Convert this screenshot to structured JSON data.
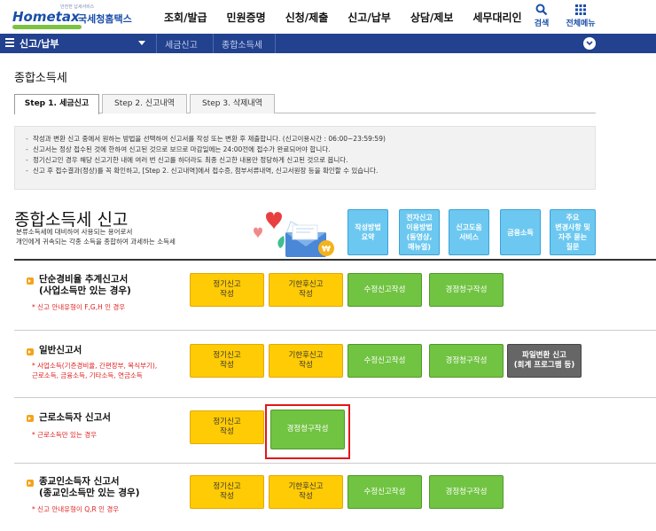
{
  "header": {
    "logo_tiny": "안전한 납세서비스",
    "logo_brand": "Hometax",
    "logo_sub": "국세청홈택스",
    "menu": [
      "조회/발급",
      "민원증명",
      "신청/제출",
      "신고/납부",
      "상담/제보",
      "세무대리인"
    ],
    "search_label": "검색",
    "all_menu_label": "전체메뉴"
  },
  "navbar": {
    "current": "신고/납부",
    "crumbs": [
      "세금신고",
      "종합소득세"
    ]
  },
  "page_title": "종합소득세",
  "tabs": [
    "Step 1. 세금신고",
    "Step 2. 신고내역",
    "Step 3. 삭제내역"
  ],
  "notice": [
    "작성과 변환 신고 중에서 원하는 방법을 선택하여 신고서를 작성 또는 변환 후 제출합니다. (신고이용시간 : 06:00~23:59:59)",
    "신고서는 정상 접수된 것에 한하여 신고된 것으로 보므로 마감일에는 24:00전에 접수가 완료되어야 합니다.",
    "정기신고인 경우 해당 신고기한 내에 여러 번 신고를 하더라도 최종 신고한 내용만 정당하게 신고된 것으로 봅니다.",
    "신고 후 접수결과(정상)를 꼭 확인하고, [Step 2. 신고내역]에서 접수증, 첨부서류내역, 신고서원장 등을 확인할 수 있습니다."
  ],
  "section": {
    "title": "종합소득세 신고",
    "desc1": "분류소득세에 대비하여 사용되는 용어로서",
    "desc2": "개인에게 귀속되는 각종 소득을 종합하여 과세하는 소득세"
  },
  "quick_buttons": [
    "작성방법\n요약",
    "전자신고\n이용방법\n(동영상,\n매뉴얼)",
    "신고도움\n서비스",
    "금융소득",
    "주요\n변경사항 및\n자주 묻는\n질문"
  ],
  "rows": [
    {
      "title": "단순경비율 추계신고서\n(사업소득만 있는 경우)",
      "note": "신고 안내유형이 F,G,H 인 경우",
      "buttons": [
        "정기신고\n작성",
        "기한후신고\n작성",
        "수정신고작성",
        "경정청구작성"
      ]
    },
    {
      "title": "일반신고서",
      "note": "사업소득(기준경비율, 간편장부, 복식부기),\n근로소득, 금융소득, 기타소득, 연금소득",
      "buttons": [
        "정기신고\n작성",
        "기한후신고\n작성",
        "수정신고작성",
        "경정청구작성",
        "파일변환 신고\n(회계 프로그램 등)"
      ]
    },
    {
      "title": "근로소득자 신고서",
      "note": "근로소득만 있는 경우",
      "buttons": [
        "정기신고\n작성",
        "경정청구작성"
      ]
    },
    {
      "title": "종교인소득자 신고서\n(종교인소득만 있는 경우)",
      "note": "신고 안내유형이 Q,R 인 경우",
      "buttons": [
        "정기신고\n작성",
        "기한후신고\n작성",
        "수정신고작성",
        "경정청구작성"
      ]
    }
  ],
  "colors": {
    "brand_blue": "#22418e",
    "yellow_button": "#ffcb05",
    "green_button": "#71c342",
    "quick_button": "#6cc8f0",
    "highlight": "#e01818"
  }
}
